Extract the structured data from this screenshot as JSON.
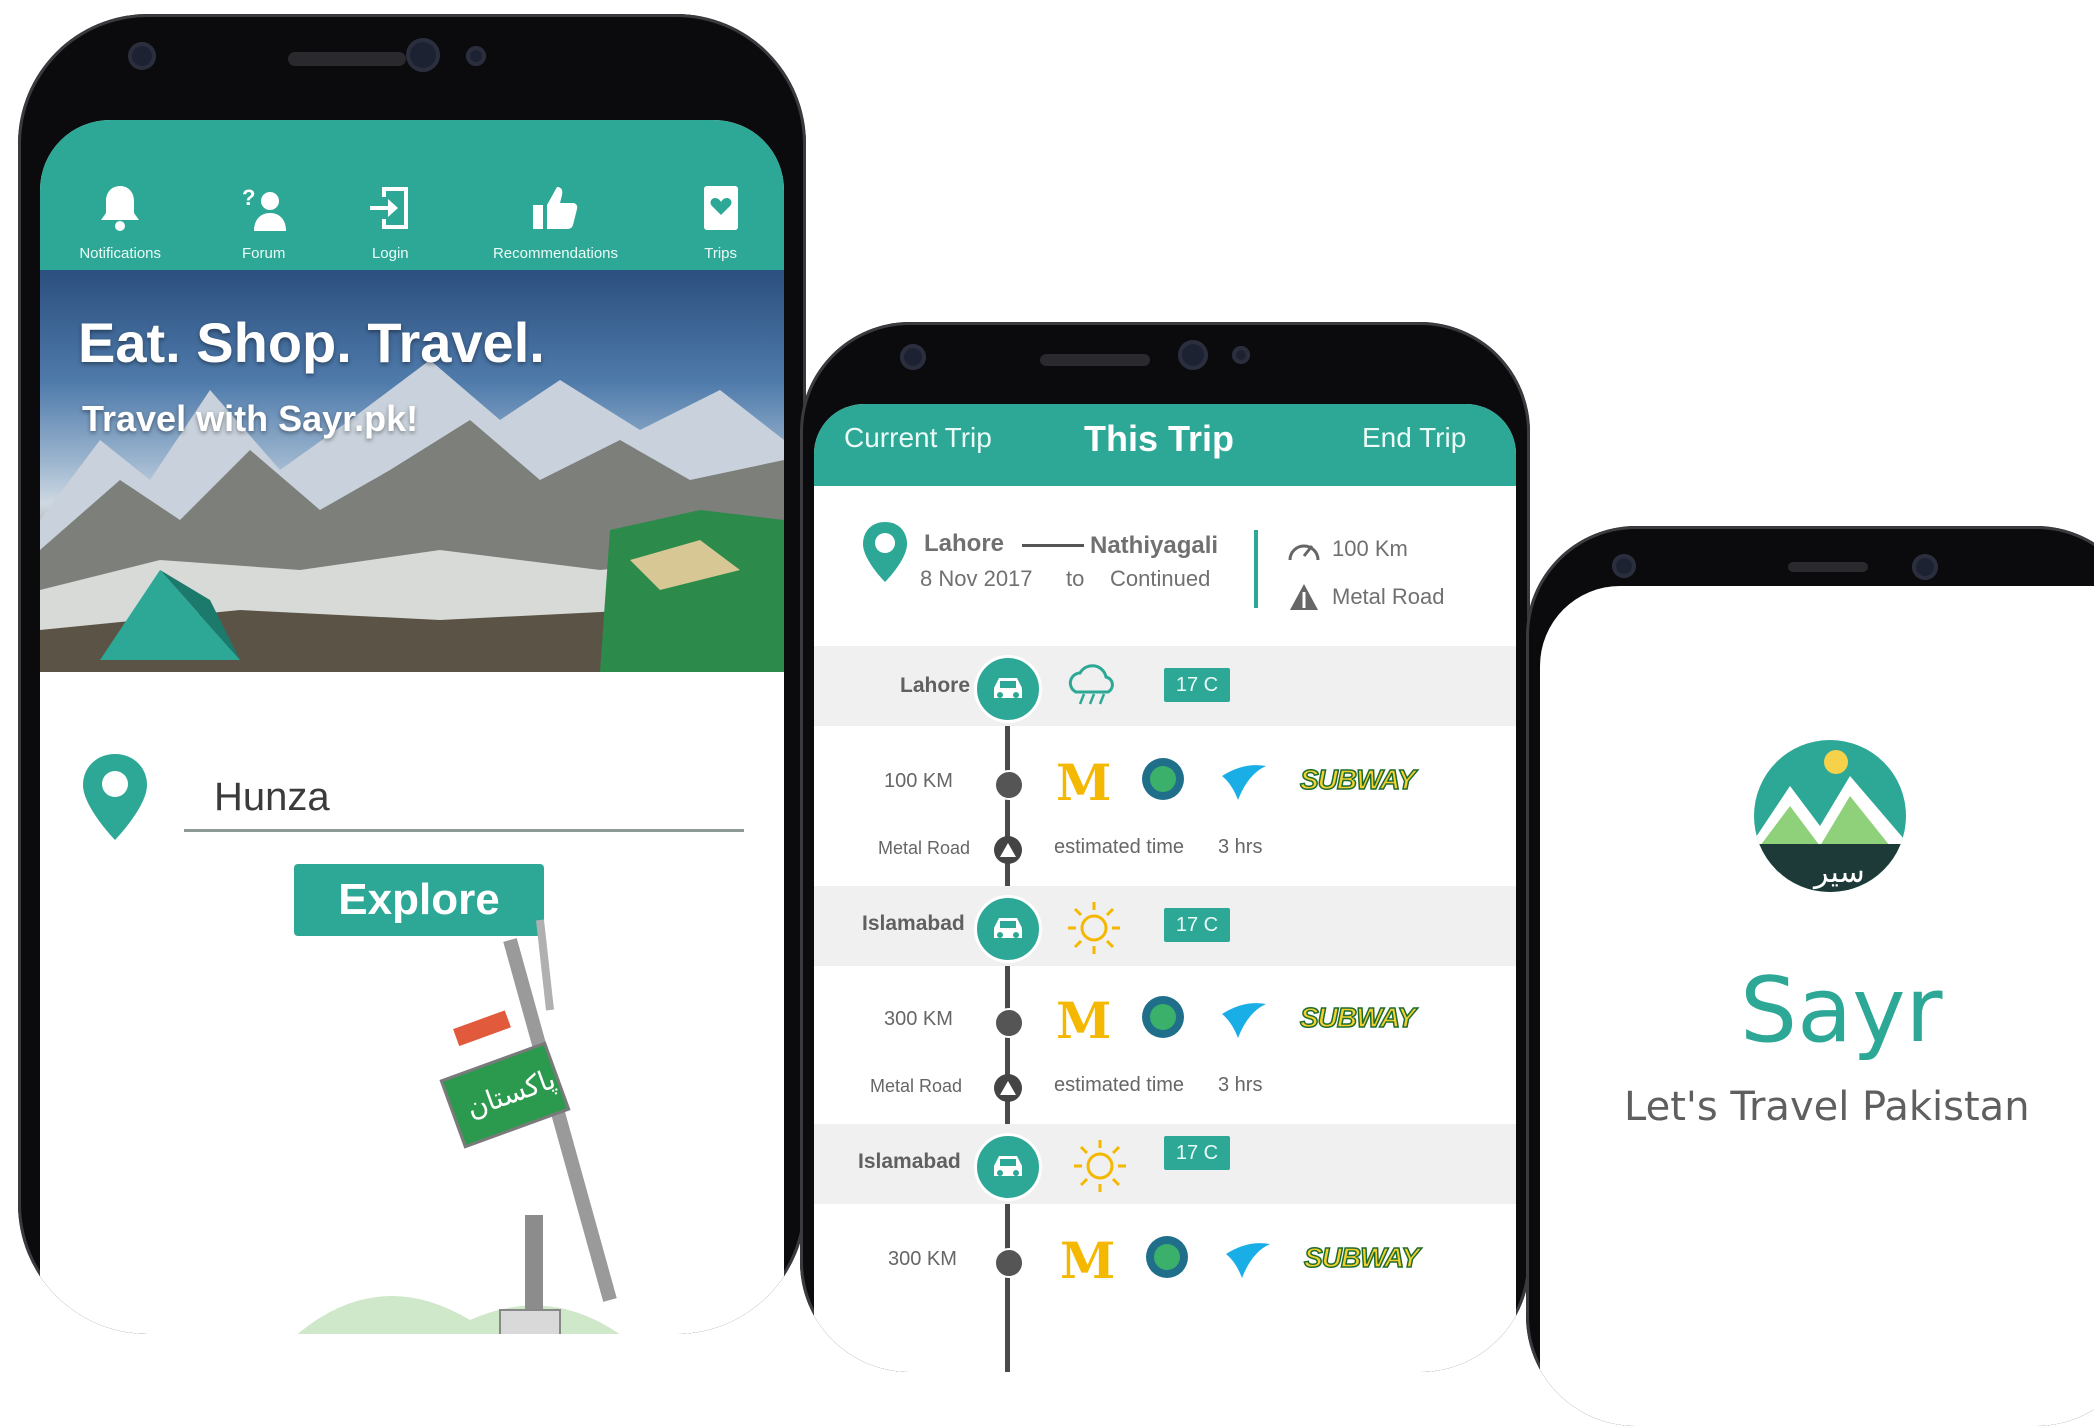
{
  "colors": {
    "accent": "#2ea896",
    "text_gray": "#666666",
    "mcdonalds": "#f5b800",
    "subway_yellow": "#f3d22d"
  },
  "phone1": {
    "nav": [
      {
        "label": "Notifications",
        "icon": "bell-icon"
      },
      {
        "label": "Forum",
        "icon": "forum-icon"
      },
      {
        "label": "Login",
        "icon": "login-icon"
      },
      {
        "label": "Recommendations",
        "icon": "thumbs-up-icon"
      },
      {
        "label": "Trips",
        "icon": "trips-icon"
      }
    ],
    "hero": {
      "title": "Eat. Shop. Travel.",
      "subtitle": "Travel with Sayr.pk!"
    },
    "search": {
      "value": "Hunza"
    },
    "explore_label": "Explore"
  },
  "phone2": {
    "tabs": {
      "left": "Current Trip",
      "center": "This Trip",
      "right": "End Trip"
    },
    "summary": {
      "from": "Lahore",
      "to_place": "Nathiyagali",
      "date": "8 Nov 2017",
      "to_word": "to",
      "status": "Continued",
      "distance": "100 Km",
      "road": "Metal Road"
    },
    "stops": [
      {
        "city": "Lahore",
        "temp": "17 C",
        "weather": "storm-cloud-icon"
      },
      {
        "city": "Islamabad",
        "temp": "17 C",
        "weather": "sun-icon"
      },
      {
        "city": "Islamabad",
        "temp": "17 C",
        "weather": "sun-icon"
      }
    ],
    "segments": [
      {
        "distance": "100 KM",
        "road": "Metal Road",
        "est_label": "estimated time",
        "est_value": "3 hrs"
      },
      {
        "distance": "300 KM",
        "road": "Metal Road",
        "est_label": "estimated time",
        "est_value": "3 hrs"
      },
      {
        "distance": "300 KM"
      }
    ],
    "brands": {
      "mcd": "M",
      "subway": "SUBWAY"
    }
  },
  "phone3": {
    "title": "Sayr",
    "tagline": "Let's Travel Pakistan",
    "logo_text": "سیر"
  }
}
